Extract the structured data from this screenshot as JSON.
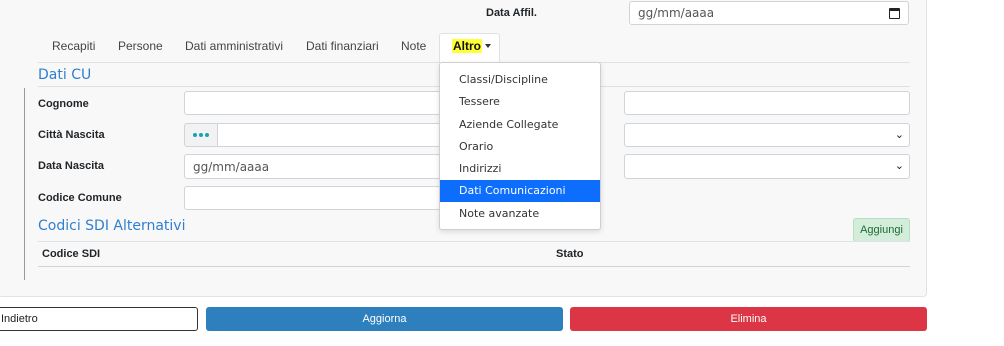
{
  "top": {
    "data_affil_label": "Data Affil.",
    "data_affil_placeholder": "gg/mm/aaaa"
  },
  "tabs": [
    {
      "label": "Recapiti"
    },
    {
      "label": "Persone"
    },
    {
      "label": "Dati amministrativi"
    },
    {
      "label": "Dati finanziari"
    },
    {
      "label": "Note"
    },
    {
      "label": "Altro"
    }
  ],
  "dropdown": {
    "items": [
      {
        "label": "Classi/Discipline"
      },
      {
        "label": "Tessere"
      },
      {
        "label": "Aziende Collegate"
      },
      {
        "label": "Orario"
      },
      {
        "label": "Indirizzi"
      },
      {
        "label": "Dati Comunicazioni",
        "active": true
      },
      {
        "label": "Note avanzate"
      }
    ]
  },
  "section_cu": {
    "title": "Dati CU",
    "cognome_label": "Cognome",
    "citta_nascita_label": "Città Nascita",
    "data_nascita_label": "Data Nascita",
    "data_nascita_placeholder": "gg/mm/aaaa",
    "codice_comune_label": "Codice Comune"
  },
  "section_sdi": {
    "title": "Codici SDI Alternativi",
    "add_button": "Aggiungi",
    "columns": [
      "Codice SDI",
      "Stato"
    ]
  },
  "footer": {
    "back_label": "Indietro",
    "update_label": "Aggiorna",
    "delete_label": "Elimina"
  },
  "colors": {
    "accent": "#2f7fd0",
    "active_menu": "#0d6efd",
    "update_button": "#2d7fbe",
    "delete_button": "#dc3545",
    "highlight": "#ffff3a"
  },
  "icons": {
    "date_picker": "calendar-icon",
    "select": "chevron-down-icon",
    "lookup": "ellipsis-icon"
  }
}
